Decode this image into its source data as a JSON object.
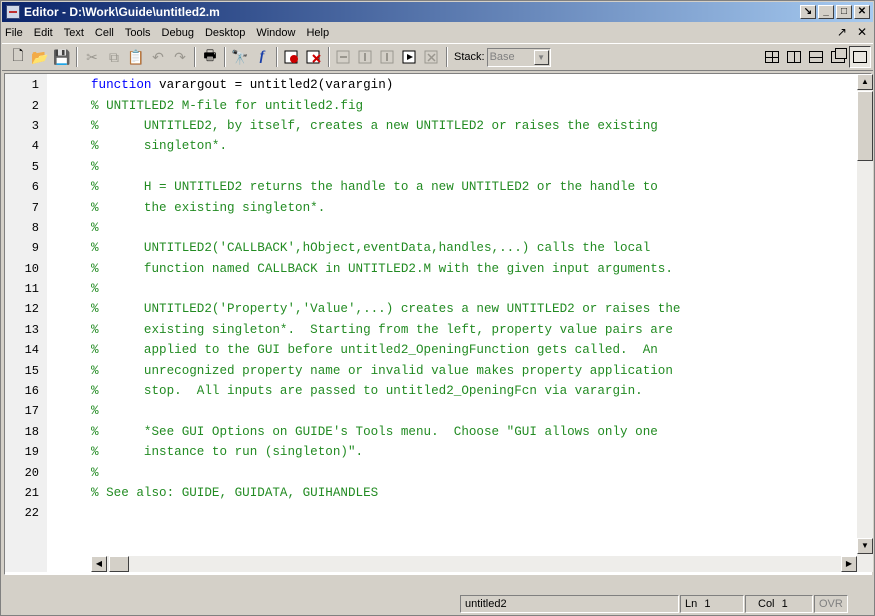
{
  "window": {
    "title": "Editor - D:\\Work\\Guide\\untitled2.m",
    "buttons": {
      "dock": "↘",
      "minimize": "_",
      "maximize": "□",
      "close": "✕"
    }
  },
  "menubar": {
    "items": [
      {
        "label": "File"
      },
      {
        "label": "Edit"
      },
      {
        "label": "Text"
      },
      {
        "label": "Cell"
      },
      {
        "label": "Tools"
      },
      {
        "label": "Debug"
      },
      {
        "label": "Desktop"
      },
      {
        "label": "Window"
      },
      {
        "label": "Help"
      }
    ],
    "right": {
      "undock": "↗",
      "close": "✕"
    }
  },
  "toolbar": {
    "icons": {
      "new": "🗋",
      "open": "📂",
      "save": "💾",
      "cut": "✂",
      "copy": "⧉",
      "paste": "📋",
      "undo": "↶",
      "redo": "↷",
      "print": "🖶",
      "find": "🔭",
      "function": "f"
    },
    "stack_label": "Stack:",
    "stack_value": "Base"
  },
  "editor": {
    "lines": [
      {
        "n": "1",
        "parts": [
          {
            "t": "kw",
            "s": "function"
          },
          {
            "t": "plain",
            "s": " varargout = untitled2(varargin)"
          }
        ]
      },
      {
        "n": "2",
        "parts": [
          {
            "t": "cm",
            "s": "% UNTITLED2 M-file for untitled2.fig"
          }
        ]
      },
      {
        "n": "3",
        "parts": [
          {
            "t": "cm",
            "s": "%      UNTITLED2, by itself, creates a new UNTITLED2 or raises the existing"
          }
        ]
      },
      {
        "n": "4",
        "parts": [
          {
            "t": "cm",
            "s": "%      singleton*."
          }
        ]
      },
      {
        "n": "5",
        "parts": [
          {
            "t": "cm",
            "s": "%"
          }
        ]
      },
      {
        "n": "6",
        "parts": [
          {
            "t": "cm",
            "s": "%      H = UNTITLED2 returns the handle to a new UNTITLED2 or the handle to"
          }
        ]
      },
      {
        "n": "7",
        "parts": [
          {
            "t": "cm",
            "s": "%      the existing singleton*."
          }
        ]
      },
      {
        "n": "8",
        "parts": [
          {
            "t": "cm",
            "s": "%"
          }
        ]
      },
      {
        "n": "9",
        "parts": [
          {
            "t": "cm",
            "s": "%      UNTITLED2('CALLBACK',hObject,eventData,handles,...) calls the local"
          }
        ]
      },
      {
        "n": "10",
        "parts": [
          {
            "t": "cm",
            "s": "%      function named CALLBACK in UNTITLED2.M with the given input arguments."
          }
        ]
      },
      {
        "n": "11",
        "parts": [
          {
            "t": "cm",
            "s": "%"
          }
        ]
      },
      {
        "n": "12",
        "parts": [
          {
            "t": "cm",
            "s": "%      UNTITLED2('Property','Value',...) creates a new UNTITLED2 or raises the"
          }
        ]
      },
      {
        "n": "13",
        "parts": [
          {
            "t": "cm",
            "s": "%      existing singleton*.  Starting from the left, property value pairs are"
          }
        ]
      },
      {
        "n": "14",
        "parts": [
          {
            "t": "cm",
            "s": "%      applied to the GUI before untitled2_OpeningFunction gets called.  An"
          }
        ]
      },
      {
        "n": "15",
        "parts": [
          {
            "t": "cm",
            "s": "%      unrecognized property name or invalid value makes property application"
          }
        ]
      },
      {
        "n": "16",
        "parts": [
          {
            "t": "cm",
            "s": "%      stop.  All inputs are passed to untitled2_OpeningFcn via varargin."
          }
        ]
      },
      {
        "n": "17",
        "parts": [
          {
            "t": "cm",
            "s": "%"
          }
        ]
      },
      {
        "n": "18",
        "parts": [
          {
            "t": "cm",
            "s": "%      *See GUI Options on GUIDE's Tools menu.  Choose \"GUI allows only one"
          }
        ]
      },
      {
        "n": "19",
        "parts": [
          {
            "t": "cm",
            "s": "%      instance to run (singleton)\"."
          }
        ]
      },
      {
        "n": "20",
        "parts": [
          {
            "t": "cm",
            "s": "%"
          }
        ]
      },
      {
        "n": "21",
        "parts": [
          {
            "t": "cm",
            "s": "% See also: GUIDE, GUIDATA, GUIHANDLES"
          }
        ]
      },
      {
        "n": "22",
        "parts": []
      }
    ]
  },
  "status": {
    "filename": "untitled2",
    "ln_label": "Ln",
    "ln_value": "1",
    "col_label": "Col",
    "col_value": "1",
    "ovr": "OVR"
  },
  "colors": {
    "keyword": "#0000ff",
    "comment": "#228b22",
    "titlebar": "#0a246a"
  }
}
